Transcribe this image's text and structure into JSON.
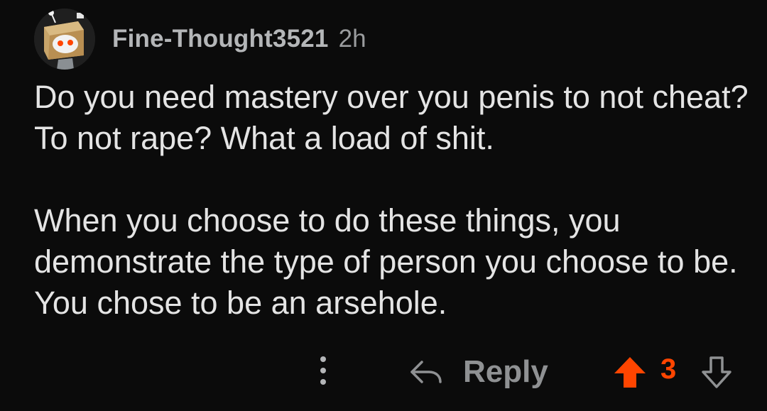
{
  "comment": {
    "author": "Fine-Thought3521",
    "age": "2h",
    "paragraphs": [
      "Do you need mastery over you penis to not cheat? To not rape? What a load of shit.",
      "When you choose to do these things, you demonstrate the type of person you choose to be. You chose to be an arsehole."
    ]
  },
  "actions": {
    "reply_label": "Reply",
    "score": "3",
    "upvote_state": "upvoted",
    "colors": {
      "upvoted": "#ff4500",
      "muted": "#8f9193"
    }
  },
  "icons": [
    "snoo-avatar-icon",
    "more-options-icon",
    "reply-arrow-icon",
    "upvote-icon",
    "downvote-icon"
  ]
}
